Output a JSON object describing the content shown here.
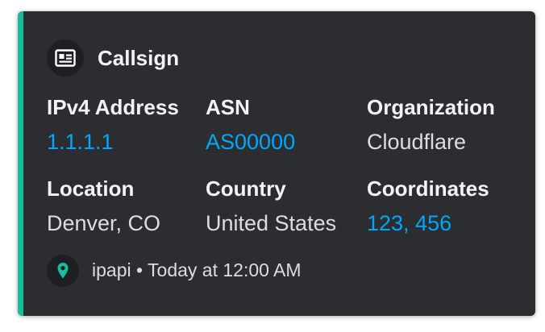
{
  "embed": {
    "accent_color": "#1abc9c",
    "author": {
      "icon": "id-card-icon",
      "name": "Callsign"
    },
    "fields": [
      {
        "name": "IPv4 Address",
        "value": "1.1.1.1",
        "link": true
      },
      {
        "name": "ASN",
        "value": "AS00000",
        "link": true
      },
      {
        "name": "Organization",
        "value": "Cloudflare",
        "link": false
      },
      {
        "name": "Location",
        "value": "Denver, CO",
        "link": false
      },
      {
        "name": "Country",
        "value": "United States",
        "link": false
      },
      {
        "name": "Coordinates",
        "value": "123, 456",
        "link": true
      }
    ],
    "footer": {
      "icon": "map-pin-icon",
      "source": "ipapi",
      "separator": "•",
      "timestamp": "Today at 12:00 AM"
    },
    "colors": {
      "background": "#2b2d31",
      "link": "#00a8fc",
      "pin": "#1abc9c"
    }
  }
}
